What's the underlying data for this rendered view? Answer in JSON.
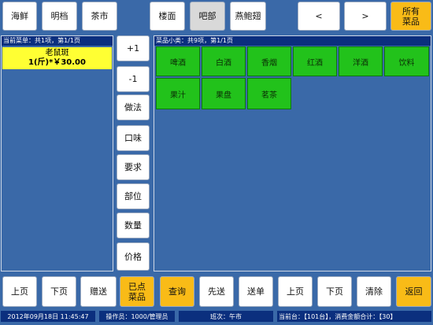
{
  "top_tabs": [
    {
      "label": "海鲜",
      "style": "white"
    },
    {
      "label": "明档",
      "style": "white"
    },
    {
      "label": "茶市",
      "style": "white"
    },
    {
      "label": "楼面",
      "style": "white"
    },
    {
      "label": "吧部",
      "style": "gray"
    },
    {
      "label": "燕鲍翅",
      "style": "white"
    }
  ],
  "nav": {
    "prev": "<",
    "next": ">",
    "all_line1": "所有",
    "all_line2": "菜品"
  },
  "current_order": {
    "header": "当前菜单：共1项，第1/1页",
    "item_name": "老鼠斑",
    "item_detail": "1(斤)*￥30.00",
    "highlight_color": "#ffff33"
  },
  "actions": [
    "+1",
    "-1",
    "做法",
    "口味",
    "要求",
    "部位",
    "数量",
    "价格"
  ],
  "dishes": {
    "header": "菜品小类：共9项，第1/1页",
    "items": [
      "啤酒",
      "白酒",
      "香烟",
      "红酒",
      "洋酒",
      "饮料",
      "果汁",
      "果盘",
      "茗茶"
    ],
    "tile_color": "#22c21b"
  },
  "bottom_bar": [
    {
      "label": "上页",
      "style": "white"
    },
    {
      "label": "下页",
      "style": "white"
    },
    {
      "label": "赠送",
      "style": "white"
    },
    {
      "label": "已点\n菜品",
      "style": "orange"
    },
    {
      "label": "查询",
      "style": "orange"
    },
    {
      "label": "先送",
      "style": "white"
    },
    {
      "label": "送单",
      "style": "white"
    },
    {
      "label": "上页",
      "style": "white"
    },
    {
      "label": "下页",
      "style": "white"
    },
    {
      "label": "清除",
      "style": "white"
    },
    {
      "label": "返回",
      "style": "orange"
    }
  ],
  "status_bar": {
    "datetime": "2012年09月18日 11:45:47",
    "operator": "操作员：1000/管理员",
    "shift": "班次：午市",
    "table_info": "当前台：【101台】，消费金额合计：【30】"
  }
}
